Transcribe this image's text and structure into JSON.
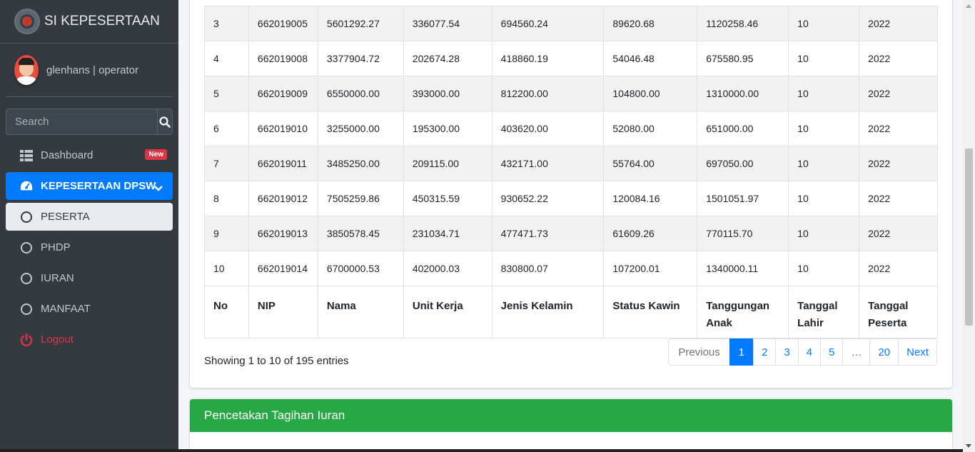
{
  "brand": {
    "title": "SI KEPESERTAAN"
  },
  "user": {
    "name": "glenhans | operator"
  },
  "search": {
    "placeholder": "Search"
  },
  "sidebar": {
    "items": [
      {
        "label": "Dashboard",
        "icon": "grid-icon",
        "badge": "New"
      },
      {
        "label": "KEPESERTAAN DPSW",
        "icon": "tachometer-icon"
      },
      {
        "label": "PESERTA",
        "icon": "circle-icon"
      },
      {
        "label": "PHDP",
        "icon": "circle-icon"
      },
      {
        "label": "IURAN",
        "icon": "circle-icon"
      },
      {
        "label": "MANFAAT",
        "icon": "circle-icon"
      },
      {
        "label": "Logout",
        "icon": "power-icon"
      }
    ]
  },
  "table": {
    "rows": [
      [
        "3",
        "662019005",
        "5601292.27",
        "336077.54",
        "694560.24",
        "89620.68",
        "1120258.46",
        "10",
        "2022"
      ],
      [
        "4",
        "662019008",
        "3377904.72",
        "202674.28",
        "418860.19",
        "54046.48",
        "675580.95",
        "10",
        "2022"
      ],
      [
        "5",
        "662019009",
        "6550000.00",
        "393000.00",
        "812200.00",
        "104800.00",
        "1310000.00",
        "10",
        "2022"
      ],
      [
        "6",
        "662019010",
        "3255000.00",
        "195300.00",
        "403620.00",
        "52080.00",
        "651000.00",
        "10",
        "2022"
      ],
      [
        "7",
        "662019011",
        "3485250.00",
        "209115.00",
        "432171.00",
        "55764.00",
        "697050.00",
        "10",
        "2022"
      ],
      [
        "8",
        "662019012",
        "7505259.86",
        "450315.59",
        "930652.22",
        "120084.16",
        "1501051.97",
        "10",
        "2022"
      ],
      [
        "9",
        "662019013",
        "3850578.45",
        "231034.71",
        "477471.73",
        "61609.26",
        "770115.70",
        "10",
        "2022"
      ],
      [
        "10",
        "662019014",
        "6700000.53",
        "402000.03",
        "830800.07",
        "107200.01",
        "1340000.11",
        "10",
        "2022"
      ]
    ],
    "footer_headers": [
      "No",
      "NIP",
      "Nama",
      "Unit Kerja",
      "Jenis Kelamin",
      "Status Kawin",
      "Tanggungan Anak",
      "Tanggal Lahir",
      "Tanggal Peserta"
    ]
  },
  "info": {
    "text": "Showing 1 to 10 of 195 entries"
  },
  "pagination": {
    "previous": "Previous",
    "pages": [
      "1",
      "2",
      "3",
      "4",
      "5",
      "…",
      "20"
    ],
    "next": "Next",
    "active": "1"
  },
  "card2": {
    "title": "Pencetakan Tagihan Iuran"
  },
  "colors": {
    "primary": "#007bff",
    "success": "#28a745",
    "danger": "#dc3545",
    "sidebar": "#343a40"
  }
}
